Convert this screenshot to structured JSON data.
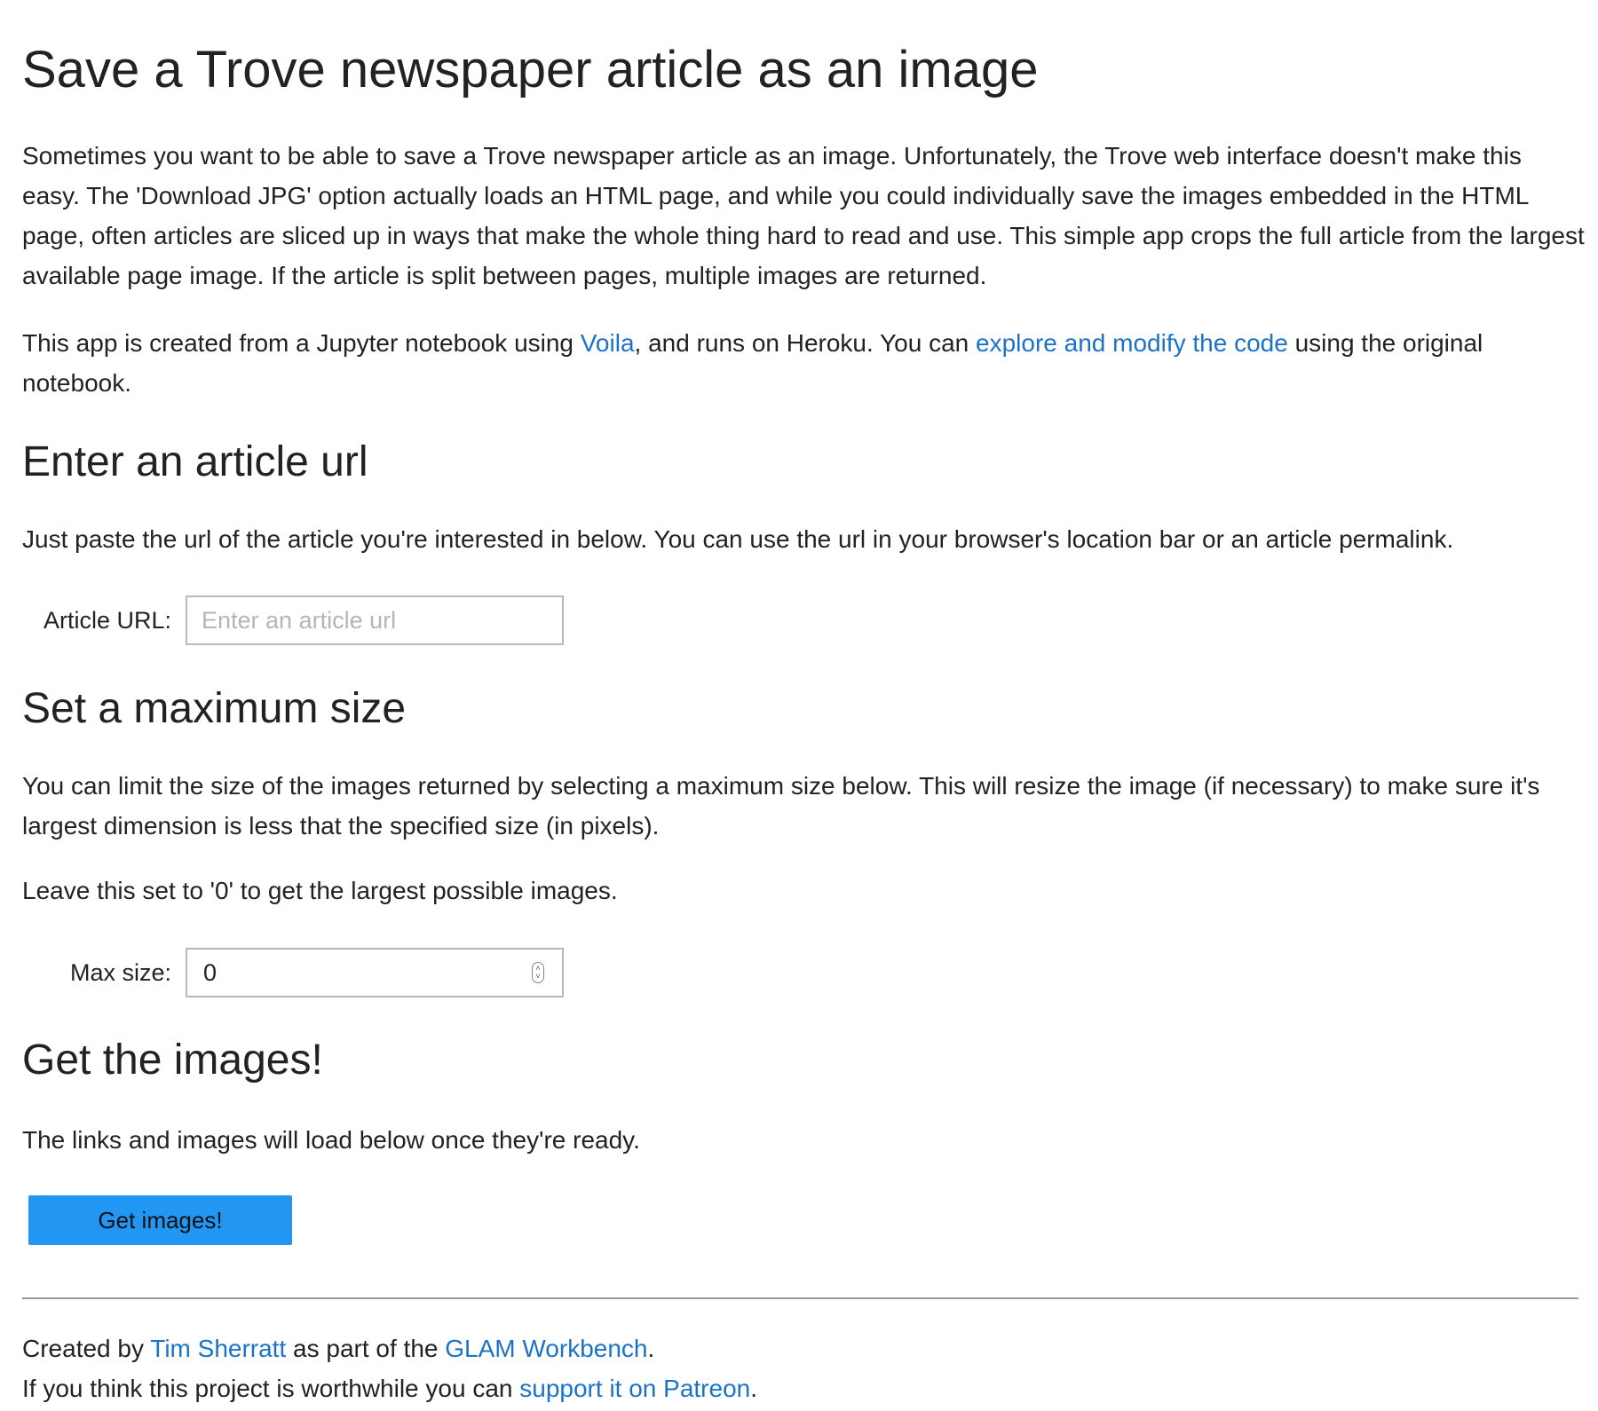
{
  "title": "Save a Trove newspaper article as an image",
  "intro": {
    "paragraph": "Sometimes you want to be able to save a Trove newspaper article as an image. Unfortunately, the Trove web interface doesn't make this easy. The 'Download JPG' option actually loads an HTML page, and while you could individually save the images embedded in the HTML page, often articles are sliced up in ways that make the whole thing hard to read and use. This simple app crops the full article from the largest available page image. If the article is split between pages, multiple images are returned.",
    "app_text_1": "This app is created from a Jupyter notebook using ",
    "voila_link": "Voila",
    "app_text_2": ", and runs on Heroku. You can ",
    "code_link": "explore and modify the code",
    "app_text_3": " using the original notebook."
  },
  "article_section": {
    "heading": "Enter an article url",
    "description": "Just paste the url of the article you're interested in below. You can use the url in your browser's location bar or an article permalink.",
    "field_label": "Article URL:",
    "placeholder": "Enter an article url",
    "value": ""
  },
  "size_section": {
    "heading": "Set a maximum size",
    "description": "You can limit the size of the images returned by selecting a maximum size below. This will resize the image (if necessary) to make sure it's largest dimension is less that the specified size (in pixels).",
    "note": "Leave this set to '0' to get the largest possible images.",
    "field_label": "Max size:",
    "value": "0"
  },
  "get_section": {
    "heading": "Get the images!",
    "description": "The links and images will load below once they're ready.",
    "button_label": "Get images!"
  },
  "footer": {
    "created_prefix": "Created by ",
    "author_link": "Tim Sherratt",
    "created_middle": " as part of the ",
    "workbench_link": "GLAM Workbench",
    "created_suffix": ".",
    "support_prefix": "If you think this project is worthwhile you can ",
    "patreon_link": "support it on Patreon",
    "support_suffix": "."
  },
  "colors": {
    "link": "#1a73c8",
    "button": "#2196f3",
    "text": "#222222"
  }
}
